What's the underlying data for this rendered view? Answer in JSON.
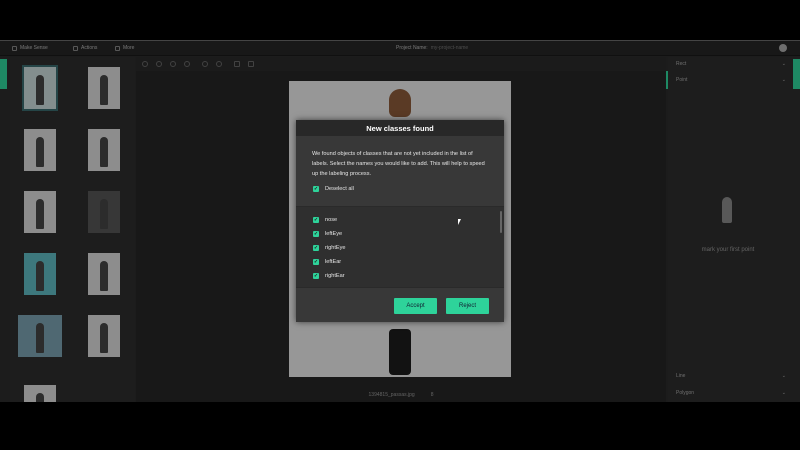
{
  "topbar": {
    "app_label": "Make Sense",
    "actions_label": "Actions",
    "more_label": "More",
    "project_name_label": "Project Name:",
    "project_name_value": "my-project-name"
  },
  "canvas": {
    "filename": "1394815_passas.jpg",
    "counter": "8"
  },
  "right_panel": {
    "rows": [
      "Rect",
      "Point",
      "Line",
      "Polygon"
    ],
    "empty_text": "mark your first point"
  },
  "dialog": {
    "title": "New classes found",
    "description": "We found objects of classes that are not yet included in the list of labels. Select the names you would like to add. This will help to speed up the labeling process.",
    "deselect_label": "Deselect all",
    "classes": [
      "nose",
      "leftEye",
      "rightEye",
      "leftEar",
      "rightEar"
    ],
    "accept_label": "Accept",
    "reject_label": "Reject"
  },
  "colors": {
    "accent": "#2ed39a",
    "dialog_bg": "#383838",
    "title_bg": "#282828"
  }
}
